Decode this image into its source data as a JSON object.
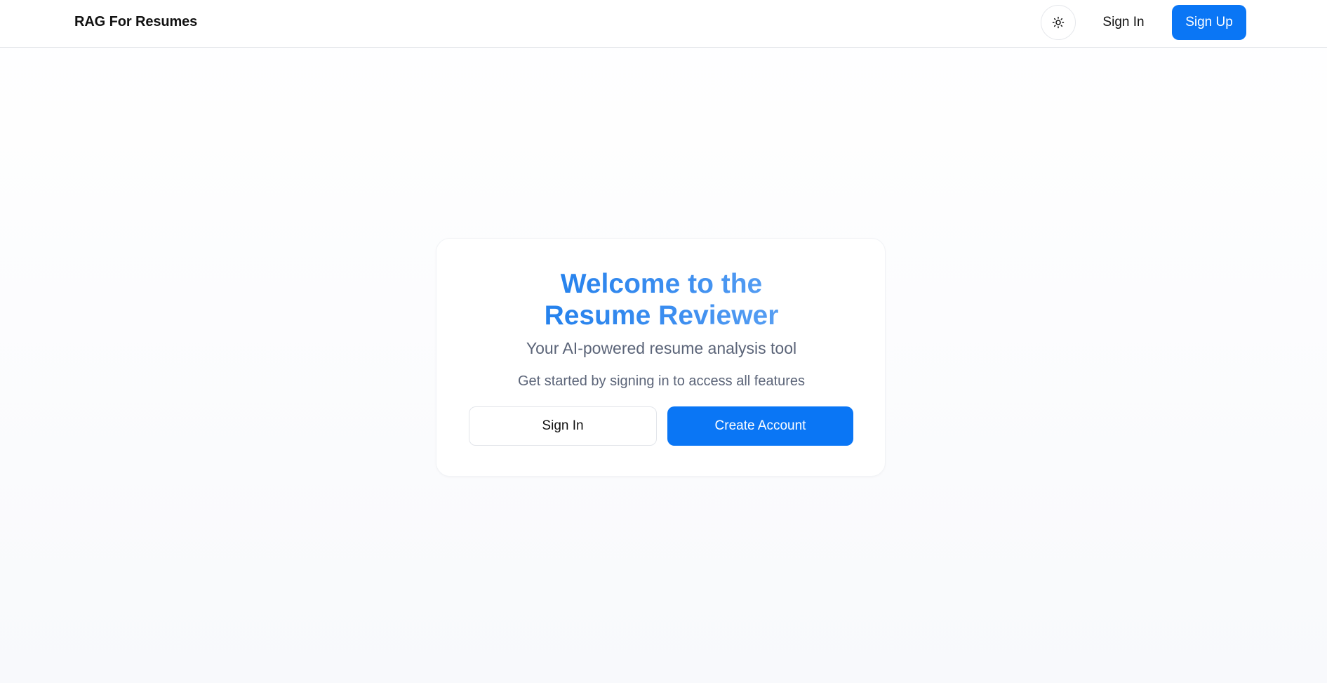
{
  "header": {
    "brand": "RAG For Resumes",
    "theme_toggle_icon": "sun-icon",
    "sign_in_label": "Sign In",
    "sign_up_label": "Sign Up"
  },
  "welcome_card": {
    "title": "Welcome to the Resume Reviewer",
    "subtitle": "Your AI-powered resume analysis tool",
    "prompt": "Get started by signing in to access all features",
    "sign_in_label": "Sign In",
    "create_account_label": "Create Account"
  },
  "colors": {
    "accent": "#0a76f5",
    "title_gradient_start": "#1177ea",
    "title_gradient_end": "#74b0f5",
    "muted_text": "#5b6478"
  }
}
